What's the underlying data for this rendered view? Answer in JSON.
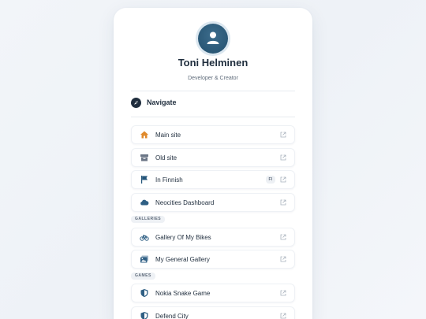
{
  "profile": {
    "name": "Toni Helminen",
    "subtitle": "Developer & Creator"
  },
  "navigate": {
    "title": "Navigate"
  },
  "items": [
    {
      "label": "Main site",
      "icon": "home-icon",
      "color": "#e08a2c"
    },
    {
      "label": "Old site",
      "icon": "archive-icon",
      "color": "#6b7686"
    },
    {
      "label": "In Finnish",
      "icon": "flag-icon",
      "color": "#24557a",
      "badge": "FI"
    },
    {
      "label": "Neocities Dashboard",
      "icon": "cloud-icon",
      "color": "#2f5f84"
    },
    {
      "label": "Gallery Of My Bikes",
      "icon": "bicycle-icon",
      "color": "#2f5f84"
    },
    {
      "label": "My General Gallery",
      "icon": "images-icon",
      "color": "#2f5f84"
    },
    {
      "label": "Nokia Snake Game",
      "icon": "shield-icon",
      "color": "#2f5f84"
    },
    {
      "label": "Defend City",
      "icon": "shield-icon",
      "color": "#2f5f84"
    }
  ],
  "sections": {
    "galleries": "GALLERIES",
    "games": "GAMES"
  },
  "colors": {
    "accent": "#2f5f84",
    "text": "#1f2d3d",
    "muted": "#5f6b7a"
  }
}
